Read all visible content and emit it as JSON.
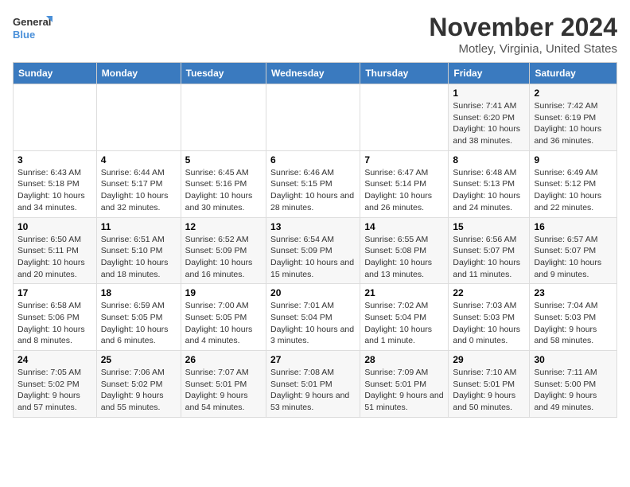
{
  "logo": {
    "line1": "General",
    "line2": "Blue"
  },
  "title": "November 2024",
  "subtitle": "Motley, Virginia, United States",
  "weekdays": [
    "Sunday",
    "Monday",
    "Tuesday",
    "Wednesday",
    "Thursday",
    "Friday",
    "Saturday"
  ],
  "weeks": [
    [
      {
        "day": "",
        "info": ""
      },
      {
        "day": "",
        "info": ""
      },
      {
        "day": "",
        "info": ""
      },
      {
        "day": "",
        "info": ""
      },
      {
        "day": "",
        "info": ""
      },
      {
        "day": "1",
        "info": "Sunrise: 7:41 AM\nSunset: 6:20 PM\nDaylight: 10 hours and 38 minutes."
      },
      {
        "day": "2",
        "info": "Sunrise: 7:42 AM\nSunset: 6:19 PM\nDaylight: 10 hours and 36 minutes."
      }
    ],
    [
      {
        "day": "3",
        "info": "Sunrise: 6:43 AM\nSunset: 5:18 PM\nDaylight: 10 hours and 34 minutes."
      },
      {
        "day": "4",
        "info": "Sunrise: 6:44 AM\nSunset: 5:17 PM\nDaylight: 10 hours and 32 minutes."
      },
      {
        "day": "5",
        "info": "Sunrise: 6:45 AM\nSunset: 5:16 PM\nDaylight: 10 hours and 30 minutes."
      },
      {
        "day": "6",
        "info": "Sunrise: 6:46 AM\nSunset: 5:15 PM\nDaylight: 10 hours and 28 minutes."
      },
      {
        "day": "7",
        "info": "Sunrise: 6:47 AM\nSunset: 5:14 PM\nDaylight: 10 hours and 26 minutes."
      },
      {
        "day": "8",
        "info": "Sunrise: 6:48 AM\nSunset: 5:13 PM\nDaylight: 10 hours and 24 minutes."
      },
      {
        "day": "9",
        "info": "Sunrise: 6:49 AM\nSunset: 5:12 PM\nDaylight: 10 hours and 22 minutes."
      }
    ],
    [
      {
        "day": "10",
        "info": "Sunrise: 6:50 AM\nSunset: 5:11 PM\nDaylight: 10 hours and 20 minutes."
      },
      {
        "day": "11",
        "info": "Sunrise: 6:51 AM\nSunset: 5:10 PM\nDaylight: 10 hours and 18 minutes."
      },
      {
        "day": "12",
        "info": "Sunrise: 6:52 AM\nSunset: 5:09 PM\nDaylight: 10 hours and 16 minutes."
      },
      {
        "day": "13",
        "info": "Sunrise: 6:54 AM\nSunset: 5:09 PM\nDaylight: 10 hours and 15 minutes."
      },
      {
        "day": "14",
        "info": "Sunrise: 6:55 AM\nSunset: 5:08 PM\nDaylight: 10 hours and 13 minutes."
      },
      {
        "day": "15",
        "info": "Sunrise: 6:56 AM\nSunset: 5:07 PM\nDaylight: 10 hours and 11 minutes."
      },
      {
        "day": "16",
        "info": "Sunrise: 6:57 AM\nSunset: 5:07 PM\nDaylight: 10 hours and 9 minutes."
      }
    ],
    [
      {
        "day": "17",
        "info": "Sunrise: 6:58 AM\nSunset: 5:06 PM\nDaylight: 10 hours and 8 minutes."
      },
      {
        "day": "18",
        "info": "Sunrise: 6:59 AM\nSunset: 5:05 PM\nDaylight: 10 hours and 6 minutes."
      },
      {
        "day": "19",
        "info": "Sunrise: 7:00 AM\nSunset: 5:05 PM\nDaylight: 10 hours and 4 minutes."
      },
      {
        "day": "20",
        "info": "Sunrise: 7:01 AM\nSunset: 5:04 PM\nDaylight: 10 hours and 3 minutes."
      },
      {
        "day": "21",
        "info": "Sunrise: 7:02 AM\nSunset: 5:04 PM\nDaylight: 10 hours and 1 minute."
      },
      {
        "day": "22",
        "info": "Sunrise: 7:03 AM\nSunset: 5:03 PM\nDaylight: 10 hours and 0 minutes."
      },
      {
        "day": "23",
        "info": "Sunrise: 7:04 AM\nSunset: 5:03 PM\nDaylight: 9 hours and 58 minutes."
      }
    ],
    [
      {
        "day": "24",
        "info": "Sunrise: 7:05 AM\nSunset: 5:02 PM\nDaylight: 9 hours and 57 minutes."
      },
      {
        "day": "25",
        "info": "Sunrise: 7:06 AM\nSunset: 5:02 PM\nDaylight: 9 hours and 55 minutes."
      },
      {
        "day": "26",
        "info": "Sunrise: 7:07 AM\nSunset: 5:01 PM\nDaylight: 9 hours and 54 minutes."
      },
      {
        "day": "27",
        "info": "Sunrise: 7:08 AM\nSunset: 5:01 PM\nDaylight: 9 hours and 53 minutes."
      },
      {
        "day": "28",
        "info": "Sunrise: 7:09 AM\nSunset: 5:01 PM\nDaylight: 9 hours and 51 minutes."
      },
      {
        "day": "29",
        "info": "Sunrise: 7:10 AM\nSunset: 5:01 PM\nDaylight: 9 hours and 50 minutes."
      },
      {
        "day": "30",
        "info": "Sunrise: 7:11 AM\nSunset: 5:00 PM\nDaylight: 9 hours and 49 minutes."
      }
    ]
  ]
}
